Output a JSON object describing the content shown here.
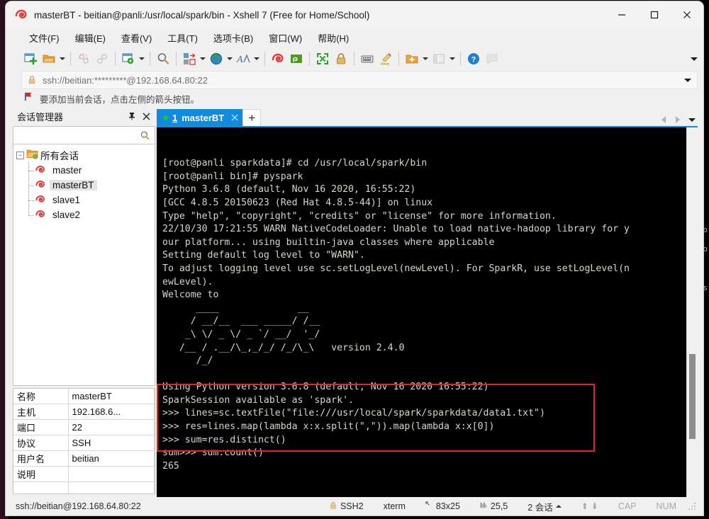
{
  "window": {
    "title": "masterBT - beitian@panli:/usr/local/spark/bin - Xshell 7 (Free for Home/School)",
    "app_icon": "xshell-icon",
    "minimize_label": "—",
    "maximize_label": "▢",
    "close_label": "✕"
  },
  "menu": {
    "items": [
      {
        "label": "文件(F)",
        "name": "menu-file"
      },
      {
        "label": "编辑(E)",
        "name": "menu-edit"
      },
      {
        "label": "查看(V)",
        "name": "menu-view"
      },
      {
        "label": "工具(T)",
        "name": "menu-tools"
      },
      {
        "label": "选项卡(B)",
        "name": "menu-tabs"
      },
      {
        "label": "窗口(W)",
        "name": "menu-window"
      },
      {
        "label": "帮助(H)",
        "name": "menu-help"
      }
    ]
  },
  "toolbar": {
    "icons": [
      "new-session-icon",
      "open-folder-icon",
      "disconnect-icon",
      "reconnect-icon",
      "session-properties-icon",
      "find-icon",
      "transfer-icon",
      "web-browser-icon",
      "font-icon",
      "xshell-icon",
      "xftp-icon",
      "fullscreen-icon",
      "lock-icon",
      "keyboard-icon",
      "highlight-icon",
      "add-to-folder-icon",
      "layout-icon",
      "help-icon",
      "chat-icon"
    ],
    "overflow_label": "▾"
  },
  "address": {
    "lock_icon": "lock-icon",
    "value": "ssh://beitian:*********@192.168.64.80:22",
    "dropdown_label": "▾"
  },
  "hint": {
    "icon": "red-flag-icon",
    "text": "要添加当前会话，点击左侧的箭头按钮。"
  },
  "session_manager": {
    "title": "会话管理器",
    "pin_label": "⊼",
    "close_label": "✕",
    "search_placeholder": "",
    "search_value": "",
    "search_icon": "search-icon",
    "tree": {
      "root_label": "所有会话",
      "root_icon": "folder-icon",
      "expander": "−",
      "children": [
        {
          "label": "master",
          "icon": "session-icon",
          "selected": false
        },
        {
          "label": "masterBT",
          "icon": "session-icon",
          "selected": true
        },
        {
          "label": "slave1",
          "icon": "session-icon",
          "selected": false
        },
        {
          "label": "slave2",
          "icon": "session-icon",
          "selected": false
        }
      ]
    },
    "properties": [
      {
        "key": "名称",
        "value": "masterBT"
      },
      {
        "key": "主机",
        "value": "192.168.6..."
      },
      {
        "key": "端口",
        "value": "22"
      },
      {
        "key": "协议",
        "value": "SSH"
      },
      {
        "key": "用户名",
        "value": "beitian"
      },
      {
        "key": "说明",
        "value": ""
      }
    ]
  },
  "tabs": {
    "items": [
      {
        "number": "1",
        "label": "masterBT",
        "active": true,
        "close_label": "✕",
        "status_dot": "#21c421"
      }
    ],
    "add_label": "+",
    "nav_prev": "◀",
    "nav_next": "▶",
    "nav_list": "▾"
  },
  "terminal": {
    "lines": [
      "[root@panli sparkdata]# cd /usr/local/spark/bin",
      "[root@panli bin]# pyspark",
      "Python 3.6.8 (default, Nov 16 2020, 16:55:22)",
      "[GCC 4.8.5 20150623 (Red Hat 4.8.5-44)] on linux",
      "Type \"help\", \"copyright\", \"credits\" or \"license\" for more information.",
      "22/10/30 17:21:55 WARN NativeCodeLoader: Unable to load native-hadoop library for y",
      "our platform... using builtin-java classes where applicable",
      "Setting default log level to \"WARN\".",
      "To adjust logging level use sc.setLogLevel(newLevel). For SparkR, use setLogLevel(n",
      "ewLevel).",
      "Welcome to",
      "      ____              __",
      "     / __/__  ___ _____/ /__",
      "    _\\ \\/ _ \\/ _ `/ __/  '_/",
      "   /__ / .__/\\_,_/_/ /_/\\_\\   version 2.4.0",
      "      /_/",
      "",
      "Using Python version 3.6.8 (default, Nov 16 2020 16:55:22)",
      "SparkSession available as 'spark'.",
      ">>> lines=sc.textFile(\"file:///usr/local/spark/sparkdata/data1.txt\")",
      ">>> res=lines.map(lambda x:x.split(\",\")).map(lambda x:x[0])",
      ">>> sum=res.distinct()",
      "sum>>> sum.count()",
      "265"
    ],
    "prompt": ">>> ",
    "cursor": "block",
    "highlight_color": "#ee2020"
  },
  "status_bar": {
    "url": "ssh://beitian@192.168.64.80:22",
    "protocol_icon": "lock-icon",
    "protocol": "SSH2",
    "term_type": "xterm",
    "size_icon": "size-icon",
    "size": "83x25",
    "pos_icon": "cursor-icon",
    "position": "25,5",
    "sessions": "2 会话",
    "sessions_caret": "▲",
    "arrow_up": "⬆",
    "arrow_down": "⬇",
    "cap": "CAP",
    "num": "NUM"
  }
}
